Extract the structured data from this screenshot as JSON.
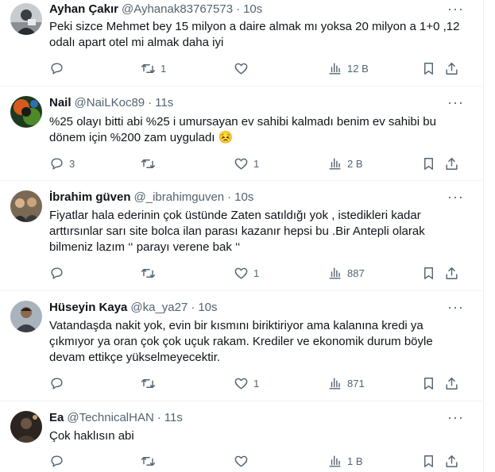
{
  "tweets": [
    {
      "name": "Ayhan Çakır",
      "handle": "@Ayhanak83767573",
      "time": "10s",
      "text": "Peki sizce Mehmet bey 15 milyon a daire almak mı yoksa 20 milyon a 1+0 ,12\nodalı apart otel mi almak daha iyi",
      "replies": "",
      "retweets": "1",
      "likes": "",
      "views": "12 B"
    },
    {
      "name": "Nail",
      "handle": "@NaiLKoc89",
      "time": "11s",
      "text": "%25 olayı bitti abi %25 i umursayan ev sahibi kalmadı benim ev sahibi bu\ndönem için %200 zam uyguladı 😣",
      "replies": "3",
      "retweets": "",
      "likes": "1",
      "views": "2 B"
    },
    {
      "name": "İbrahim güven",
      "handle": "@_ibrahimguven",
      "time": "10s",
      "text": "Fiyatlar hala ederinin çok üstünde Zaten satıldığı yok , istedikleri kadar\narttırsınlar sarı site bolca ilan parası kazanır hepsi bu .Bir Antepli olarak\nbilmeniz lazım ‘‘ parayı verene bak ‘‘",
      "replies": "",
      "retweets": "",
      "likes": "1",
      "views": "887"
    },
    {
      "name": "Hüseyin Kaya",
      "handle": "@ka_ya27",
      "time": "10s",
      "text": "Vatandaşda nakit yok, evin bir kısmını biriktiriyor ama kalanına kredi ya\nçıkmıyor ya oran çok çok uçuk rakam. Krediler ve ekonomik durum  böyle\ndevam ettikçe yükselmeyecektir.",
      "replies": "",
      "retweets": "",
      "likes": "1",
      "views": "871"
    },
    {
      "name": "Ea",
      "handle": "@TechnicalHAN",
      "time": "11s",
      "text": "Çok haklısın abi",
      "replies": "",
      "retweets": "",
      "likes": "",
      "views": "1 B"
    }
  ],
  "icons": {
    "reply": "reply-icon",
    "retweet": "retweet-icon",
    "like": "heart-icon",
    "views": "views-icon",
    "bookmark": "bookmark-icon",
    "share": "share-icon",
    "more": "more-icon"
  },
  "colors": {
    "text": "#0f1419",
    "secondary": "#536471",
    "divider": "#eff3f4"
  }
}
